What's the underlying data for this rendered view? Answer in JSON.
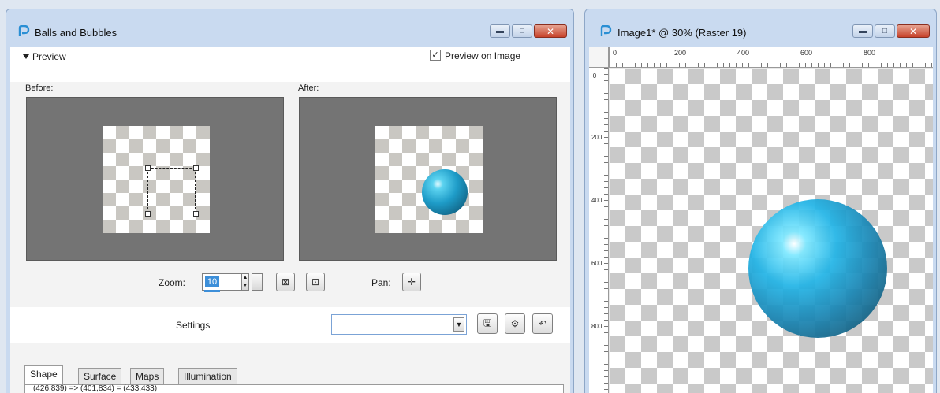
{
  "dialog": {
    "title": "Balls and Bubbles",
    "preview_section": "Preview",
    "preview_on_image": {
      "label": "Preview on Image",
      "checked": true
    },
    "before_label": "Before:",
    "after_label": "After:",
    "zoom": {
      "label": "Zoom:",
      "value": "10"
    },
    "pan_label": "Pan:",
    "settings": {
      "label": "Settings",
      "value": ""
    },
    "tabs": [
      {
        "label": "Shape",
        "active": true
      },
      {
        "label": "Surface",
        "active": false
      },
      {
        "label": "Maps",
        "active": false
      },
      {
        "label": "Illumination",
        "active": false
      }
    ],
    "shape_readout": "(426,839) => (401,834) = (433,433)"
  },
  "image_window": {
    "title": "Image1* @  30% (Raster 19)",
    "ruler_top_labels": [
      "0",
      "200",
      "400",
      "600",
      "800"
    ],
    "ruler_left_labels": [
      "0",
      "200",
      "400",
      "600",
      "800"
    ]
  },
  "colors": {
    "titlebar": "#c9daf0",
    "ball": "#1e9cc8",
    "preview_bg": "#747474",
    "close_button": "#c7432b"
  },
  "icons": {
    "app": "paintshop-pro-icon",
    "minimize": "minimize-icon",
    "maximize": "maximize-icon",
    "close": "close-icon",
    "zoom_fit": "zoom-fit-icon",
    "zoom_actual": "zoom-actual-icon",
    "pan": "pan-icon",
    "save_preset": "save-icon",
    "preset_options": "preset-options-icon",
    "reset": "reset-icon"
  }
}
